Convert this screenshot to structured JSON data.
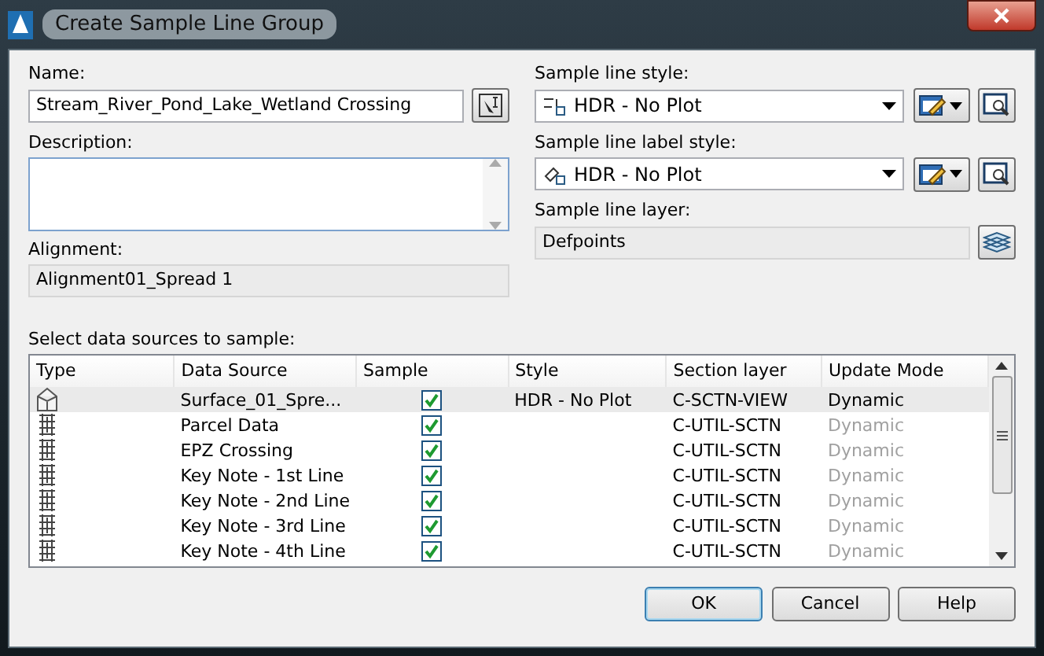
{
  "window": {
    "title": "Create Sample Line Group"
  },
  "name": {
    "label": "Name:",
    "value": "Stream_River_Pond_Lake_Wetland Crossing"
  },
  "description": {
    "label": "Description:"
  },
  "alignment": {
    "label": "Alignment:",
    "value": "Alignment01_Spread 1"
  },
  "sample_line_style": {
    "label": "Sample line style:",
    "value": "HDR - No Plot"
  },
  "sample_line_label_style": {
    "label": "Sample line label style:",
    "value": "HDR - No Plot"
  },
  "sample_line_layer": {
    "label": "Sample line layer:",
    "value": "Defpoints"
  },
  "data_sources": {
    "label": "Select data sources to sample:",
    "columns": [
      "Type",
      "Data Source",
      "Sample",
      "Style",
      "Section layer",
      "Update Mode"
    ],
    "rows": [
      {
        "kind": "surface",
        "source": "Surface_01_Spre...",
        "checked": true,
        "style": "HDR - No Plot",
        "layer": "C-SCTN-VIEW",
        "mode": "Dynamic",
        "selected": true,
        "disabled": false
      },
      {
        "kind": "pipe",
        "source": "Parcel Data",
        "checked": true,
        "layer": "C-UTIL-SCTN",
        "mode": "Dynamic",
        "selected": false,
        "disabled": true
      },
      {
        "kind": "pipe",
        "source": "EPZ Crossing",
        "checked": true,
        "layer": "C-UTIL-SCTN",
        "mode": "Dynamic",
        "selected": false,
        "disabled": true
      },
      {
        "kind": "pipe",
        "source": "Key Note - 1st Line",
        "checked": true,
        "layer": "C-UTIL-SCTN",
        "mode": "Dynamic",
        "selected": false,
        "disabled": true
      },
      {
        "kind": "pipe",
        "source": "Key Note - 2nd Line",
        "checked": true,
        "layer": "C-UTIL-SCTN",
        "mode": "Dynamic",
        "selected": false,
        "disabled": true
      },
      {
        "kind": "pipe",
        "source": "Key Note - 3rd Line",
        "checked": true,
        "layer": "C-UTIL-SCTN",
        "mode": "Dynamic",
        "selected": false,
        "disabled": true
      },
      {
        "kind": "pipe",
        "source": "Key Note - 4th Line",
        "checked": true,
        "layer": "C-UTIL-SCTN",
        "mode": "Dynamic",
        "selected": false,
        "disabled": true
      }
    ]
  },
  "buttons": [
    "OK",
    "Cancel",
    "Help"
  ]
}
